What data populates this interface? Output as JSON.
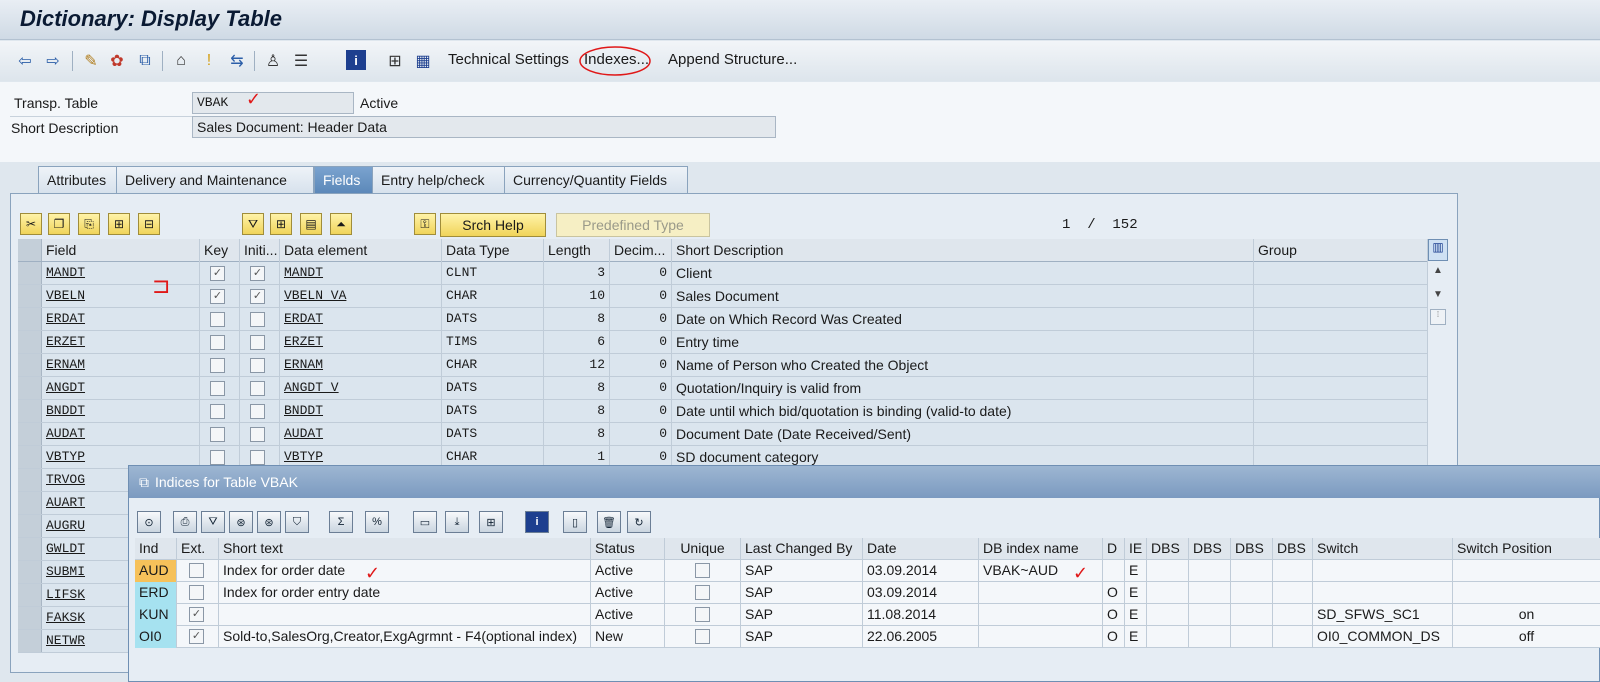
{
  "window": {
    "title": "Dictionary: Display Table"
  },
  "toolbar": {
    "icons": [
      "back-arrow-icon",
      "forward-arrow-icon",
      "pencil-glasses-icon",
      "activate-icon",
      "check-icon",
      "where-used-icon",
      "object-list-icon",
      "navigation-icon",
      "hierarchy-icon",
      "graphic-icon",
      "info-icon",
      "structure-icon",
      "table-icon"
    ],
    "technical_settings": "Technical Settings",
    "indexes": "Indexes...",
    "append_structure": "Append Structure..."
  },
  "header": {
    "transp_table_label": "Transp. Table",
    "transp_table_value": "VBAK",
    "status": "Active",
    "short_desc_label": "Short Description",
    "short_desc_value": "Sales Document: Header Data"
  },
  "tabs": [
    "Attributes",
    "Delivery and Maintenance",
    "Fields",
    "Entry help/check",
    "Currency/Quantity Fields"
  ],
  "active_tab": "Fields",
  "grid_toolbar": {
    "srch_help": "Srch Help",
    "predefined_type": "Predefined Type",
    "pager": "1  /  152"
  },
  "fields_table": {
    "headers": [
      "Field",
      "Key",
      "Initi...",
      "Data element",
      "Data Type",
      "Length",
      "Decim...",
      "Short Description",
      "Group"
    ],
    "rows": [
      {
        "field": "MANDT",
        "key": true,
        "init": true,
        "element": "MANDT",
        "type": "CLNT",
        "length": "3",
        "dec": "0",
        "desc": "Client"
      },
      {
        "field": "VBELN",
        "key": true,
        "init": true,
        "element": "VBELN_VA",
        "type": "CHAR",
        "length": "10",
        "dec": "0",
        "desc": "Sales Document"
      },
      {
        "field": "ERDAT",
        "key": false,
        "init": false,
        "element": "ERDAT",
        "type": "DATS",
        "length": "8",
        "dec": "0",
        "desc": "Date on Which Record Was Created"
      },
      {
        "field": "ERZET",
        "key": false,
        "init": false,
        "element": "ERZET",
        "type": "TIMS",
        "length": "6",
        "dec": "0",
        "desc": "Entry time"
      },
      {
        "field": "ERNAM",
        "key": false,
        "init": false,
        "element": "ERNAM",
        "type": "CHAR",
        "length": "12",
        "dec": "0",
        "desc": "Name of Person who Created the Object"
      },
      {
        "field": "ANGDT",
        "key": false,
        "init": false,
        "element": "ANGDT_V",
        "type": "DATS",
        "length": "8",
        "dec": "0",
        "desc": "Quotation/Inquiry is valid from"
      },
      {
        "field": "BNDDT",
        "key": false,
        "init": false,
        "element": "BNDDT",
        "type": "DATS",
        "length": "8",
        "dec": "0",
        "desc": "Date until which bid/quotation is binding (valid-to date)"
      },
      {
        "field": "AUDAT",
        "key": false,
        "init": false,
        "element": "AUDAT",
        "type": "DATS",
        "length": "8",
        "dec": "0",
        "desc": "Document Date (Date Received/Sent)"
      },
      {
        "field": "VBTYP",
        "key": false,
        "init": false,
        "element": "VBTYP",
        "type": "CHAR",
        "length": "1",
        "dec": "0",
        "desc": "SD document category"
      },
      {
        "field": "TRVOG",
        "key": false,
        "init": false,
        "element": "",
        "type": "",
        "length": "",
        "dec": "",
        "desc": ""
      },
      {
        "field": "AUART",
        "key": false,
        "init": false,
        "element": "",
        "type": "",
        "length": "",
        "dec": "",
        "desc": ""
      },
      {
        "field": "AUGRU",
        "key": false,
        "init": false,
        "element": "",
        "type": "",
        "length": "",
        "dec": "",
        "desc": ""
      },
      {
        "field": "GWLDT",
        "key": false,
        "init": false,
        "element": "",
        "type": "",
        "length": "",
        "dec": "",
        "desc": ""
      },
      {
        "field": "SUBMI",
        "key": false,
        "init": false,
        "element": "",
        "type": "",
        "length": "",
        "dec": "",
        "desc": ""
      },
      {
        "field": "LIFSK",
        "key": false,
        "init": false,
        "element": "",
        "type": "",
        "length": "",
        "dec": "",
        "desc": ""
      },
      {
        "field": "FAKSK",
        "key": false,
        "init": false,
        "element": "",
        "type": "",
        "length": "",
        "dec": "",
        "desc": ""
      },
      {
        "field": "NETWR",
        "key": false,
        "init": false,
        "element": "",
        "type": "",
        "length": "",
        "dec": "",
        "desc": ""
      }
    ]
  },
  "popup": {
    "title": "Indices for Table VBAK",
    "headers": [
      "Ind",
      "Ext.",
      "Short text",
      "Status",
      "Unique",
      "Last Changed By",
      "Date",
      "DB index name",
      "D",
      "IE",
      "DBS",
      "DBS",
      "DBS",
      "DBS",
      "Switch",
      "Switch Position"
    ],
    "rows": [
      {
        "ind": "AUD",
        "ext": false,
        "text": "Index for order date",
        "status": "Active",
        "unique": false,
        "by": "SAP",
        "date": "03.09.2014",
        "dbname": "VBAK~AUD",
        "d": "",
        "ie": "E",
        "switch": "",
        "pos": ""
      },
      {
        "ind": "ERD",
        "ext": false,
        "text": "Index for order entry date",
        "status": "Active",
        "unique": false,
        "by": "SAP",
        "date": "03.09.2014",
        "dbname": "",
        "d": "O",
        "ie": "E",
        "switch": "",
        "pos": ""
      },
      {
        "ind": "KUN",
        "ext": true,
        "text": "",
        "status": "Active",
        "unique": false,
        "by": "SAP",
        "date": "11.08.2014",
        "dbname": "",
        "d": "O",
        "ie": "E",
        "switch": "SD_SFWS_SC1",
        "pos": "on"
      },
      {
        "ind": "OI0",
        "ext": true,
        "text": "Sold-to,SalesOrg,Creator,ExgAgrmnt - F4(optional index)",
        "status": "New",
        "unique": false,
        "by": "SAP",
        "date": "22.06.2005",
        "dbname": "",
        "d": "O",
        "ie": "E",
        "switch": "OI0_COMMON_DS",
        "pos": "off"
      }
    ]
  }
}
